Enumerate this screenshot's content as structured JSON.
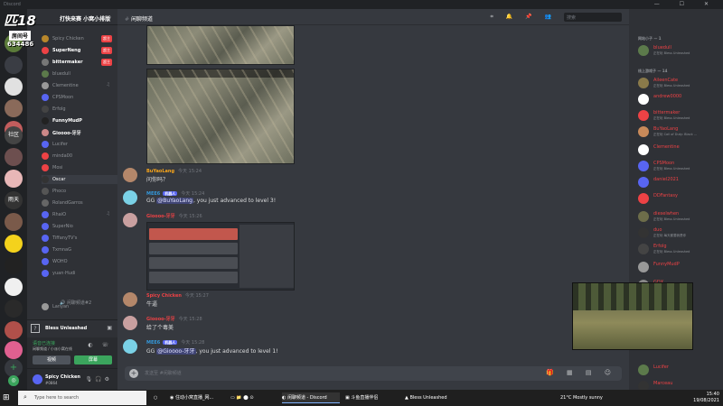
{
  "window": {
    "title": "Discord"
  },
  "overlay": {
    "big": "匹18",
    "box": "房间号",
    "number": "634486"
  },
  "servers": [
    "",
    "",
    "",
    "",
    "",
    "社区",
    "",
    "",
    "雨天",
    "",
    "",
    "",
    "",
    "",
    "",
    "",
    "",
    ""
  ],
  "sidebar": {
    "header": "打快来赛 小窝小排版",
    "members": [
      {
        "name": "Spicy Chicken",
        "tag": "超主"
      },
      {
        "name": "SuperNeng",
        "tag": "超主"
      },
      {
        "name": "bittermaker",
        "tag": "超主"
      },
      {
        "name": "bluedull"
      },
      {
        "name": "Clementine"
      },
      {
        "name": "CPSMoon"
      },
      {
        "name": "Erfolg"
      },
      {
        "name": "FunnyMudP"
      },
      {
        "name": "Gioooo-牙牙"
      },
      {
        "name": "Lucifer"
      },
      {
        "name": "minda00"
      },
      {
        "name": "Mosi"
      },
      {
        "name": "Oscar"
      },
      {
        "name": "Phoco"
      },
      {
        "name": "RolandGarros"
      },
      {
        "name": "RhaiO"
      },
      {
        "name": "SuperNio"
      },
      {
        "name": "TiffanyTV's"
      },
      {
        "name": "TxmnaG"
      },
      {
        "name": "WOHO"
      },
      {
        "name": "yuan·Hudi"
      }
    ],
    "voice_channel": "闲聊频道#2",
    "voice_user": "Lanyan",
    "game_status": "Bless Unleashed",
    "voice_connected": "语音已连接",
    "voice_sub": "闲聊频道 / 小派小窝在线",
    "btn_video": "视频",
    "btn_screen": "屏幕"
  },
  "user": {
    "name": "Spicy Chicken",
    "tag": "#0864"
  },
  "chat": {
    "channel": "闲聊频道",
    "search_placeholder": "搜索",
    "composer_placeholder": "发送至 #闲聊频道",
    "messages": [
      {
        "author": "BuYaoLang",
        "time": "今天 15:24",
        "text": "问你吗？"
      },
      {
        "author": "MEE6",
        "bot": "机器人",
        "time": "今天 15:24",
        "pre": "GG ",
        "mention": "@BuYaoLang",
        "post": ", you just advanced to level 3!"
      },
      {
        "author": "Gioooo-牙牙",
        "time": "今天 15:26",
        "text": ""
      },
      {
        "author": "Spicy Chicken",
        "time": "今天 15:27",
        "text": "牛逼"
      },
      {
        "author": "Gioooo-牙牙",
        "time": "今天 15:28",
        "text": "给了个毒美"
      },
      {
        "author": "MEE6",
        "bot": "机器人",
        "time": "今天 15:28",
        "pre": "GG ",
        "mention": "@Gioooo-牙牙",
        "post": ", you just advanced to level 1!"
      }
    ]
  },
  "members_panel": {
    "group1": "网站小子 — 1",
    "group2": "线上游戏子 — 14",
    "list": [
      {
        "name": "bluedull",
        "status": "正在玩 Bless Unleashed"
      },
      {
        "name": "AileenCate",
        "status": "正在玩 Bless Unleashed"
      },
      {
        "name": "andrew0000",
        "status": ""
      },
      {
        "name": "bittermaker",
        "status": "正在玩 Bless Unleashed"
      },
      {
        "name": "BuYaoLang",
        "status": "正在玩 Call of Duty: Black ..."
      },
      {
        "name": "Clementine",
        "status": ""
      },
      {
        "name": "CPSMoon",
        "status": "正在玩 Bless Unleashed"
      },
      {
        "name": "daniel2021",
        "status": ""
      },
      {
        "name": "DDFantasy",
        "status": ""
      },
      {
        "name": "dieselwhen",
        "status": "正在玩 Bless Unleashed"
      },
      {
        "name": "duo",
        "status": "正在玩 每天都要我是你"
      },
      {
        "name": "Erfolg",
        "status": "正在玩 Bless Unleashed"
      },
      {
        "name": "FunnyMudP",
        "status": ""
      },
      {
        "name": "GDX",
        "status": ""
      },
      {
        "name": "Lucifer",
        "status": ""
      },
      {
        "name": "Marceau",
        "status": ""
      }
    ]
  },
  "taskbar": {
    "search": "Type here to search",
    "apps": [
      "住动小窝直播_网...",
      "闲聊频道 - Discord",
      "斗鱼直播伴侣",
      "Bless Unleashed"
    ],
    "weather": "21°C  Mostly sunny",
    "time": "15:40",
    "date": "19/08/2021"
  }
}
